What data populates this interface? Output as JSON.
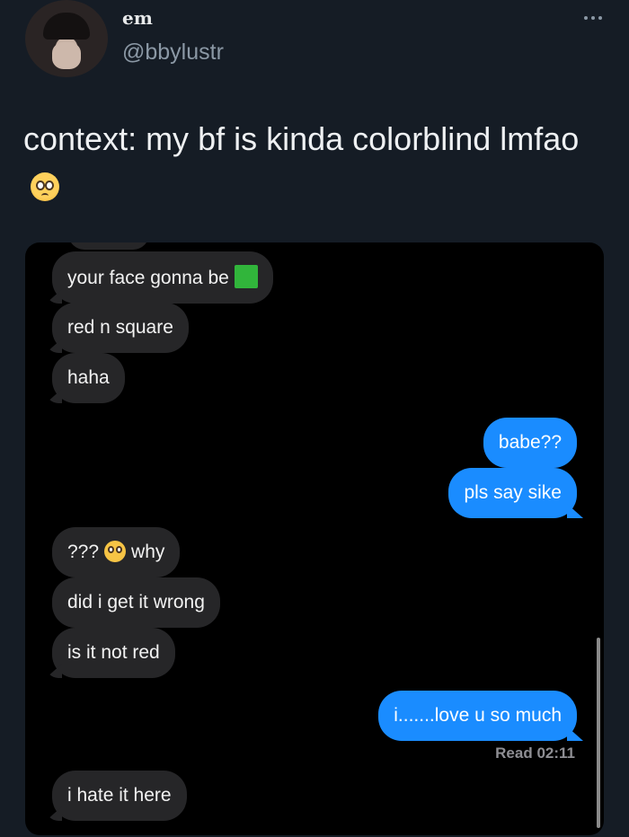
{
  "tweet": {
    "display_name": "em",
    "handle": "@bbylustr",
    "text": "context: my bf is kinda colorblind lmfao",
    "emoji": "pleading-face"
  },
  "messages": [
    {
      "side": "in",
      "text": "your face gonna be",
      "emoji": "green-square"
    },
    {
      "side": "in",
      "text": "red n square"
    },
    {
      "side": "in",
      "text": "haha"
    },
    {
      "side": "out",
      "text": "babe??"
    },
    {
      "side": "out",
      "text": "pls say sike"
    },
    {
      "side": "in",
      "text_before": "???",
      "emoji": "pleading-face",
      "text_after": "why"
    },
    {
      "side": "in",
      "text": "did i get it wrong"
    },
    {
      "side": "in",
      "text": "is it not red"
    },
    {
      "side": "out",
      "text": "i.......love u so much"
    },
    {
      "side": "in",
      "text": "i hate it here"
    }
  ],
  "read_receipt": "Read 02:11",
  "colors": {
    "background": "#151c25",
    "incoming_bubble": "#262628",
    "outgoing_bubble": "#1a8cff",
    "green_square": "#31b53b"
  },
  "icons": [
    "more-icon",
    "pleading-face-emoji",
    "green-square-emoji"
  ]
}
